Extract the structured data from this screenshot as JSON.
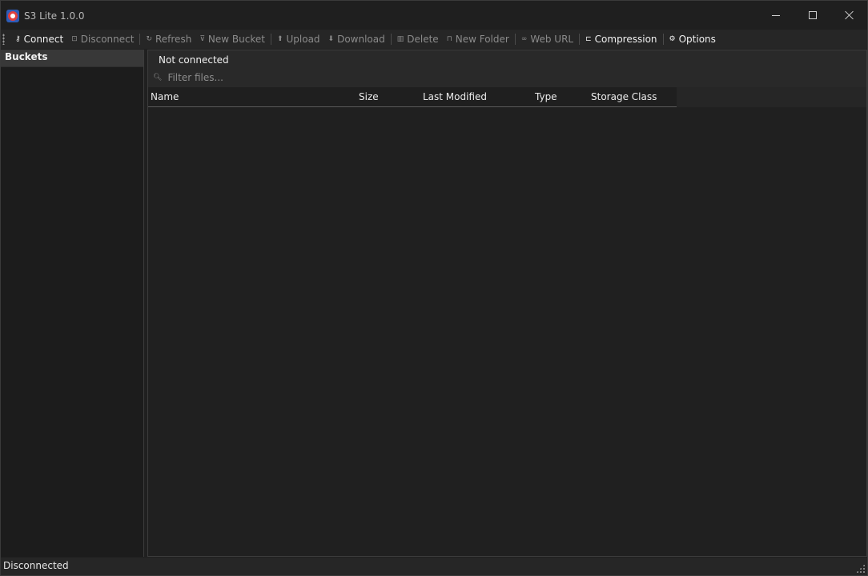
{
  "window": {
    "title": "S3 Lite 1.0.0",
    "app_icon": "s3-lite-logo-icon",
    "controls": [
      "minimize-icon",
      "maximize-icon",
      "close-icon"
    ]
  },
  "toolbar": {
    "items": [
      {
        "label": "Connect",
        "icon": "key-icon",
        "glyph": "⚷",
        "enabled": true
      },
      {
        "label": "Disconnect",
        "icon": "disconnect-icon",
        "glyph": "⊡",
        "enabled": false
      },
      {
        "label": "Refresh",
        "icon": "refresh-icon",
        "glyph": "↻",
        "enabled": false
      },
      {
        "label": "New Bucket",
        "icon": "bucket-icon",
        "glyph": "⊽",
        "enabled": false
      },
      {
        "label": "Upload",
        "icon": "upload-icon",
        "glyph": "⬆",
        "enabled": false
      },
      {
        "label": "Download",
        "icon": "download-icon",
        "glyph": "⬇",
        "enabled": false
      },
      {
        "label": "Delete",
        "icon": "trash-icon",
        "glyph": "▥",
        "enabled": false
      },
      {
        "label": "New Folder",
        "icon": "folder-icon",
        "glyph": "⊓",
        "enabled": false
      },
      {
        "label": "Web URL",
        "icon": "link-icon",
        "glyph": "∞",
        "enabled": false
      },
      {
        "label": "Compression",
        "icon": "compression-icon",
        "glyph": "⊏",
        "enabled": true
      },
      {
        "label": "Options",
        "icon": "gear-icon",
        "glyph": "⚙",
        "enabled": true
      }
    ]
  },
  "sidebar": {
    "header": "Buckets"
  },
  "main": {
    "connection_status": "Not connected",
    "filter": {
      "placeholder": "Filter files...",
      "value": ""
    },
    "columns": [
      "Name",
      "Size",
      "Last Modified",
      "Type",
      "Storage Class"
    ],
    "rows": []
  },
  "statusbar": {
    "text": "Disconnected"
  },
  "colors": {
    "background": "#202020",
    "panel": "#292929",
    "text": "#f0f0f0",
    "disabled_text": "#8b8b8b"
  }
}
